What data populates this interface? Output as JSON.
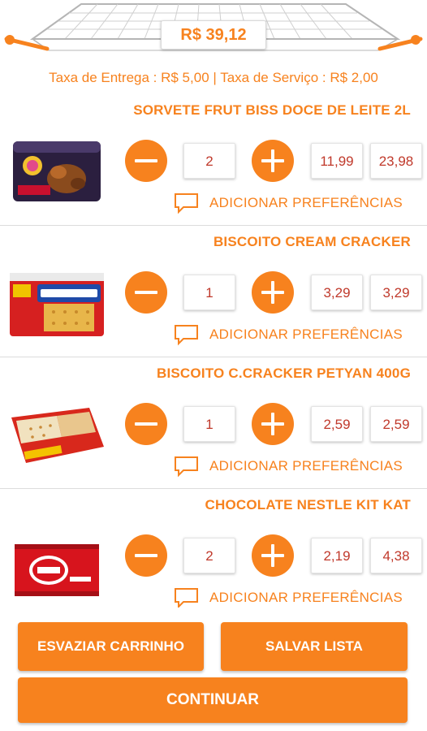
{
  "header": {
    "total": "R$  39,12",
    "fees": "Taxa de Entrega : R$ 5,00 | Taxa de Serviço : R$ 2,00"
  },
  "items": [
    {
      "name": "SORVETE FRUT BISS DOCE DE LEITE 2L",
      "qty": "2",
      "unit_price": "11,99",
      "subtotal": "23,98",
      "pref_label": "ADICIONAR PREFERÊNCIAS",
      "image": "ice-cream-tub"
    },
    {
      "name": "BISCOITO CREAM CRACKER",
      "qty": "1",
      "unit_price": "3,29",
      "subtotal": "3,29",
      "pref_label": "ADICIONAR PREFERÊNCIAS",
      "image": "cream-cracker-pack"
    },
    {
      "name": "BISCOITO C.CRACKER PETYAN 400G",
      "qty": "1",
      "unit_price": "2,59",
      "subtotal": "2,59",
      "pref_label": "ADICIONAR PREFERÊNCIAS",
      "image": "cracker-pack"
    },
    {
      "name": "CHOCOLATE NESTLE KIT KAT",
      "qty": "2",
      "unit_price": "2,19",
      "subtotal": "4,38",
      "pref_label": "ADICIONAR PREFERÊNCIAS",
      "image": "kitkat-bar"
    }
  ],
  "actions": {
    "empty_cart": "ESVAZIAR CARRINHO",
    "save_list": "SALVAR LISTA",
    "continue": "CONTINUAR"
  },
  "colors": {
    "accent": "#f7821e",
    "price_text": "#c0392b",
    "divider": "#dcdcdc"
  }
}
